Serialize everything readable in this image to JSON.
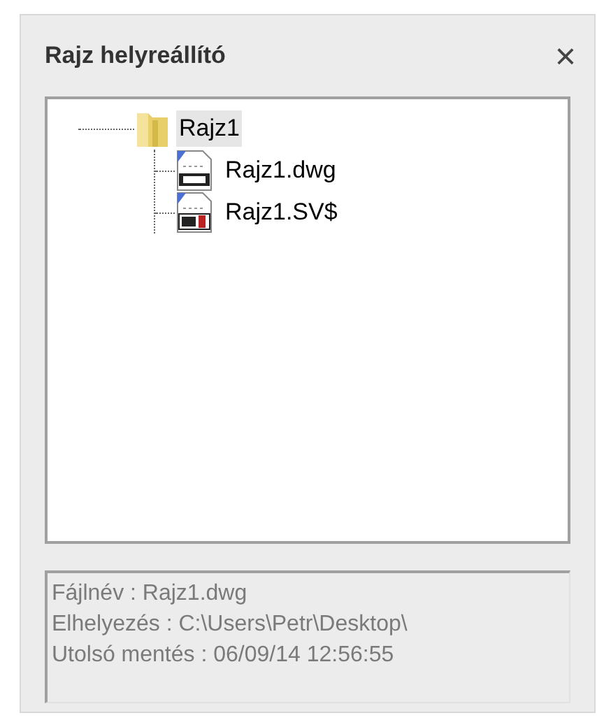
{
  "window": {
    "title": "Rajz helyreállító",
    "close": "×"
  },
  "tree": [
    {
      "label": "Rajz1",
      "kind": "folder",
      "selected": true,
      "children": [
        {
          "label": "Rajz1.dwg",
          "kind": "dwg",
          "selected": false
        },
        {
          "label": "Rajz1.SV$",
          "kind": "svs",
          "selected": false
        }
      ]
    }
  ],
  "info": [
    "Fájlnév : Rajz1.dwg",
    "Elhelyezés : C:\\Users\\Petr\\Desktop\\",
    "Utolsó mentés : 06/09/14 12:56:55"
  ]
}
